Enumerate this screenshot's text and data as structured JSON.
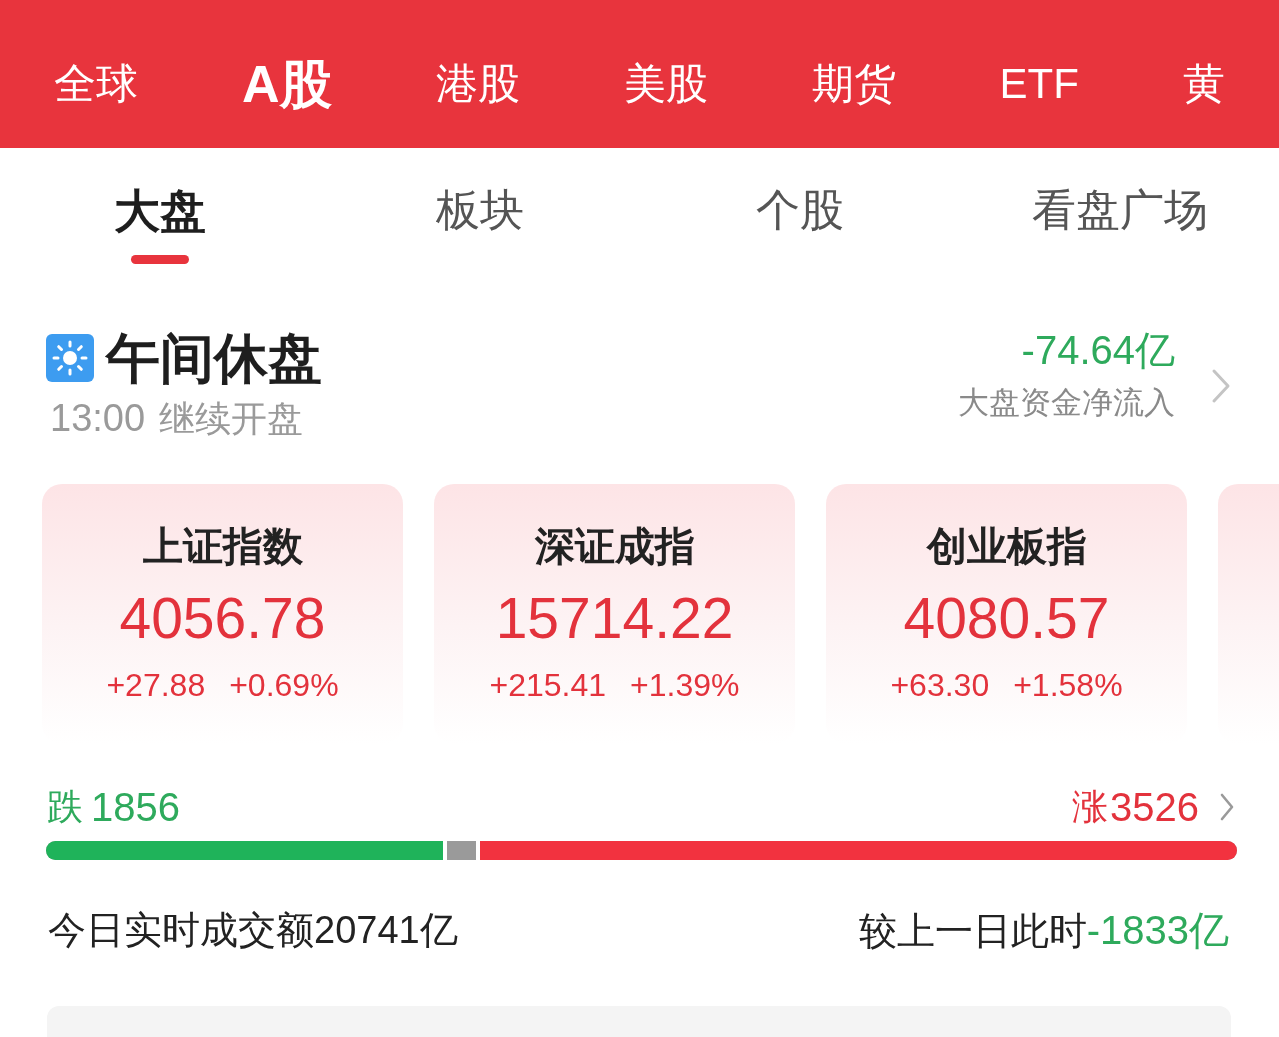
{
  "market_tabs": [
    {
      "label": "全球",
      "selected": false
    },
    {
      "label": "A股",
      "selected": true
    },
    {
      "label": "港股",
      "selected": false
    },
    {
      "label": "美股",
      "selected": false
    },
    {
      "label": "期货",
      "selected": false
    },
    {
      "label": "ETF",
      "selected": false
    },
    {
      "label": "黄",
      "selected": false
    }
  ],
  "sub_tabs": [
    {
      "label": "大盘",
      "selected": true
    },
    {
      "label": "板块",
      "selected": false
    },
    {
      "label": "个股",
      "selected": false
    },
    {
      "label": "看盘广场",
      "selected": false
    }
  ],
  "session": {
    "title": "午间休盘",
    "time": "13:00",
    "note": "继续开盘"
  },
  "net_flow": {
    "value": "-74.64亿",
    "label": "大盘资金净流入"
  },
  "index_cards": [
    {
      "name": "上证指数",
      "value": "4056.78",
      "change": "+27.88",
      "change_pct": "+0.69%"
    },
    {
      "name": "深证成指",
      "value": "15714.22",
      "change": "+215.41",
      "change_pct": "+1.39%"
    },
    {
      "name": "创业板指",
      "value": "4080.57",
      "change": "+63.30",
      "change_pct": "+1.58%"
    }
  ],
  "breadth": {
    "down_label": "跌",
    "down_count": "1856",
    "up_label": "涨",
    "up_count": "3526",
    "fills": [
      {
        "kind": "down",
        "level": 0.337,
        "color": "#1fb35a"
      },
      {
        "kind": "up",
        "level": 0.639,
        "color": "#f2323f"
      }
    ]
  },
  "turnover": {
    "text": "今日实时成交额20741亿",
    "compare_label": "较上一日此时",
    "compare_value": "-1833亿"
  }
}
